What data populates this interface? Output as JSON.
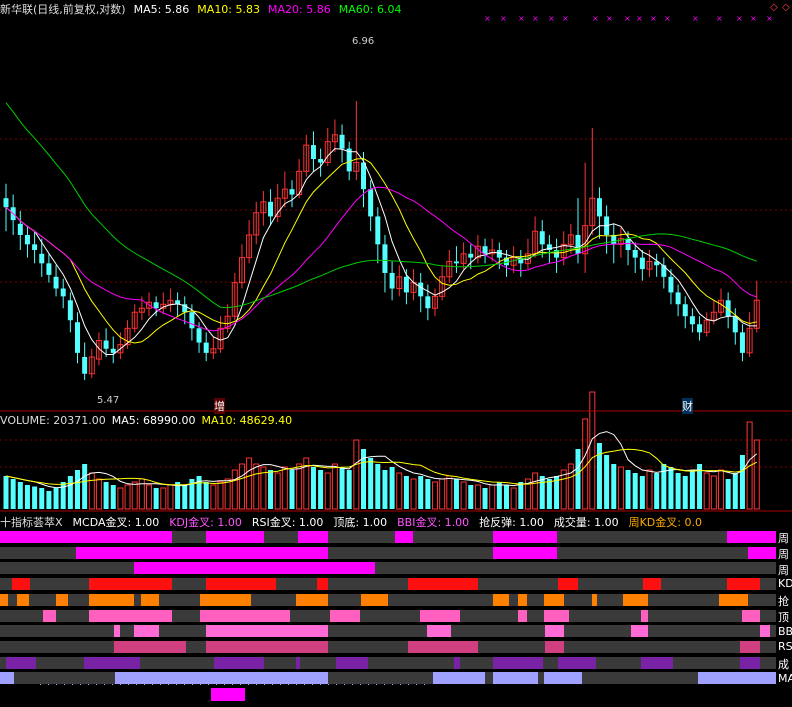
{
  "header": {
    "title": "新华联(日线,前复权,对数)",
    "ma5": "MA5: 5.86",
    "ma10": "MA10: 5.83",
    "ma20": "MA20: 5.86",
    "ma60": "MA60: 6.04",
    "icons": [
      "diamond-icon",
      "diamond-icon"
    ]
  },
  "main": {
    "high_label": "6.96",
    "low_label": "5.47",
    "mark1": "增",
    "mark2": "财"
  },
  "volume_header": {
    "volume": "VOLUME: 20371.00",
    "ma5": "MA5: 68990.00",
    "ma10": "MA10: 48629.40"
  },
  "indicator_header": {
    "name": "十指标荟萃X",
    "items": [
      "MCDA金叉: 1.00",
      "KDJ金叉: 1.00",
      "RSI金叉: 1.00",
      "顶底: 1.00",
      "BBI金叉: 1.00",
      "抢反弹: 1.00",
      "成交量: 1.00",
      "周KD金叉: 0.0"
    ]
  },
  "rows": [
    "周",
    "周",
    "周",
    "KD",
    "抢",
    "顶",
    "BB",
    "RS",
    "成",
    "MA"
  ],
  "colors": {
    "up": "#ff3232",
    "down": "#54ffff",
    "ma5": "#ffffff",
    "ma10": "#ffff00",
    "ma20": "#ff00ff",
    "ma60": "#00cc00",
    "grid": "#7a0000",
    "separator": "#aa0000"
  },
  "chart_data": {
    "type": "candlestick",
    "price_axis": "log",
    "high_marker": 6.96,
    "low_marker": 5.47,
    "moving_averages": [
      {
        "name": "MA5",
        "value": 5.86
      },
      {
        "name": "MA10",
        "value": 5.83
      },
      {
        "name": "MA20",
        "value": 5.86
      },
      {
        "name": "MA60",
        "value": 6.04
      }
    ],
    "volume": {
      "last": 20371.0,
      "ma5": 68990.0,
      "ma10": 48629.4
    },
    "price_range": [
      5.4,
      7.4
    ],
    "candles": [
      [
        6.4,
        6.35,
        6.48,
        6.22
      ],
      [
        6.35,
        6.28,
        6.42,
        6.2
      ],
      [
        6.26,
        6.2,
        6.33,
        6.12
      ],
      [
        6.2,
        6.15,
        6.25,
        6.08
      ],
      [
        6.15,
        6.12,
        6.22,
        6.05
      ],
      [
        6.1,
        6.05,
        6.18,
        5.98
      ],
      [
        6.05,
        5.99,
        6.1,
        5.95
      ],
      [
        5.98,
        5.92,
        6.04,
        5.88
      ],
      [
        5.92,
        5.88,
        5.97,
        5.82
      ],
      [
        5.86,
        5.76,
        5.9,
        5.7
      ],
      [
        5.75,
        5.6,
        5.8,
        5.55
      ],
      [
        5.58,
        5.5,
        5.65,
        5.47
      ],
      [
        5.5,
        5.58,
        5.62,
        5.48
      ],
      [
        5.57,
        5.66,
        5.7,
        5.54
      ],
      [
        5.66,
        5.62,
        5.72,
        5.58
      ],
      [
        5.62,
        5.6,
        5.68,
        5.55
      ],
      [
        5.6,
        5.64,
        5.7,
        5.57
      ],
      [
        5.64,
        5.72,
        5.76,
        5.62
      ],
      [
        5.72,
        5.8,
        5.84,
        5.7
      ],
      [
        5.8,
        5.82,
        5.88,
        5.76
      ],
      [
        5.82,
        5.85,
        5.9,
        5.78
      ],
      [
        5.85,
        5.82,
        5.88,
        5.78
      ],
      [
        5.82,
        5.84,
        5.9,
        5.79
      ],
      [
        5.84,
        5.86,
        5.92,
        5.8
      ],
      [
        5.86,
        5.84,
        5.9,
        5.78
      ],
      [
        5.84,
        5.8,
        5.88,
        5.74
      ],
      [
        5.8,
        5.72,
        5.84,
        5.66
      ],
      [
        5.72,
        5.65,
        5.75,
        5.6
      ],
      [
        5.65,
        5.6,
        5.7,
        5.56
      ],
      [
        5.6,
        5.62,
        5.68,
        5.57
      ],
      [
        5.62,
        5.72,
        5.78,
        5.6
      ],
      [
        5.72,
        5.78,
        5.84,
        5.7
      ],
      [
        5.78,
        5.95,
        6.0,
        5.76
      ],
      [
        5.95,
        6.08,
        6.15,
        5.92
      ],
      [
        6.08,
        6.2,
        6.28,
        6.05
      ],
      [
        6.2,
        6.32,
        6.38,
        6.15
      ],
      [
        6.32,
        6.38,
        6.44,
        6.25
      ],
      [
        6.38,
        6.3,
        6.45,
        6.25
      ],
      [
        6.3,
        6.4,
        6.48,
        6.27
      ],
      [
        6.4,
        6.45,
        6.55,
        6.35
      ],
      [
        6.45,
        6.42,
        6.5,
        6.35
      ],
      [
        6.42,
        6.55,
        6.62,
        6.4
      ],
      [
        6.55,
        6.7,
        6.76,
        6.52
      ],
      [
        6.7,
        6.62,
        6.78,
        6.55
      ],
      [
        6.62,
        6.6,
        6.68,
        6.52
      ],
      [
        6.6,
        6.72,
        6.8,
        6.58
      ],
      [
        6.72,
        6.76,
        6.85,
        6.66
      ],
      [
        6.76,
        6.68,
        6.82,
        6.6
      ],
      [
        6.68,
        6.55,
        6.72,
        6.5
      ],
      [
        6.55,
        6.6,
        6.96,
        6.5
      ],
      [
        6.6,
        6.45,
        6.66,
        6.35
      ],
      [
        6.45,
        6.3,
        6.5,
        6.22
      ],
      [
        6.3,
        6.15,
        6.35,
        6.05
      ],
      [
        6.15,
        6.0,
        6.2,
        5.9
      ],
      [
        6.0,
        5.92,
        6.06,
        5.86
      ],
      [
        5.92,
        5.98,
        6.04,
        5.88
      ],
      [
        5.98,
        5.9,
        6.02,
        5.84
      ],
      [
        5.9,
        5.95,
        6.02,
        5.86
      ],
      [
        5.95,
        5.88,
        6.0,
        5.8
      ],
      [
        5.88,
        5.82,
        5.94,
        5.76
      ],
      [
        5.82,
        5.88,
        5.92,
        5.78
      ],
      [
        5.88,
        5.98,
        6.04,
        5.86
      ],
      [
        5.98,
        6.06,
        6.12,
        5.95
      ],
      [
        6.06,
        6.05,
        6.14,
        6.0
      ],
      [
        6.05,
        6.1,
        6.16,
        6.02
      ],
      [
        6.1,
        6.08,
        6.15,
        6.02
      ],
      [
        6.08,
        6.14,
        6.2,
        6.05
      ],
      [
        6.14,
        6.1,
        6.18,
        6.05
      ],
      [
        6.1,
        6.12,
        6.18,
        6.06
      ],
      [
        6.12,
        6.08,
        6.16,
        6.02
      ],
      [
        6.08,
        6.04,
        6.12,
        5.98
      ],
      [
        6.04,
        6.08,
        6.14,
        6.0
      ],
      [
        6.08,
        6.05,
        6.12,
        5.98
      ],
      [
        6.05,
        6.1,
        6.18,
        6.02
      ],
      [
        6.1,
        6.22,
        6.3,
        6.08
      ],
      [
        6.22,
        6.15,
        6.28,
        6.08
      ],
      [
        6.15,
        6.12,
        6.2,
        6.05
      ],
      [
        6.12,
        6.08,
        6.18,
        6.0
      ],
      [
        6.08,
        6.15,
        6.22,
        6.04
      ],
      [
        6.15,
        6.2,
        6.26,
        6.1
      ],
      [
        6.2,
        6.1,
        6.4,
        6.05
      ],
      [
        6.1,
        6.25,
        6.6,
        6.0
      ],
      [
        6.25,
        6.4,
        6.8,
        6.2
      ],
      [
        6.4,
        6.3,
        6.46,
        6.18
      ],
      [
        6.3,
        6.2,
        6.36,
        6.1
      ],
      [
        6.2,
        6.15,
        6.26,
        6.05
      ],
      [
        6.15,
        6.18,
        6.24,
        6.08
      ],
      [
        6.18,
        6.12,
        6.22,
        6.04
      ],
      [
        6.12,
        6.08,
        6.16,
        6.0
      ],
      [
        6.08,
        6.02,
        6.12,
        5.96
      ],
      [
        6.02,
        6.06,
        6.12,
        5.98
      ],
      [
        6.06,
        6.04,
        6.1,
        5.98
      ],
      [
        6.04,
        5.98,
        6.08,
        5.92
      ],
      [
        5.98,
        5.9,
        6.02,
        5.84
      ],
      [
        5.9,
        5.84,
        5.94,
        5.78
      ],
      [
        5.84,
        5.78,
        5.88,
        5.72
      ],
      [
        5.78,
        5.74,
        5.82,
        5.7
      ],
      [
        5.74,
        5.7,
        5.78,
        5.66
      ],
      [
        5.7,
        5.76,
        5.8,
        5.68
      ],
      [
        5.76,
        5.8,
        5.86,
        5.74
      ],
      [
        5.8,
        5.86,
        5.92,
        5.78
      ],
      [
        5.86,
        5.78,
        5.9,
        5.72
      ],
      [
        5.78,
        5.7,
        5.82,
        5.64
      ],
      [
        5.7,
        5.6,
        5.74,
        5.56
      ],
      [
        5.6,
        5.72,
        5.8,
        5.58
      ],
      [
        5.72,
        5.86,
        5.96,
        5.7
      ]
    ],
    "volumes": [
      22,
      20,
      18,
      16,
      15,
      14,
      12,
      14,
      18,
      22,
      26,
      30,
      24,
      20,
      18,
      16,
      14,
      16,
      18,
      20,
      16,
      14,
      14,
      16,
      18,
      16,
      20,
      22,
      18,
      16,
      18,
      20,
      26,
      30,
      34,
      30,
      28,
      26,
      24,
      28,
      26,
      30,
      34,
      28,
      26,
      24,
      30,
      28,
      26,
      46,
      40,
      34,
      30,
      26,
      28,
      24,
      22,
      20,
      22,
      20,
      18,
      20,
      22,
      20,
      18,
      16,
      16,
      14,
      16,
      18,
      16,
      14,
      18,
      20,
      24,
      22,
      20,
      22,
      26,
      30,
      40,
      60,
      78,
      44,
      36,
      30,
      28,
      26,
      24,
      22,
      26,
      24,
      30,
      28,
      24,
      22,
      26,
      30,
      24,
      22,
      26,
      20,
      24,
      36,
      58,
      46
    ]
  }
}
